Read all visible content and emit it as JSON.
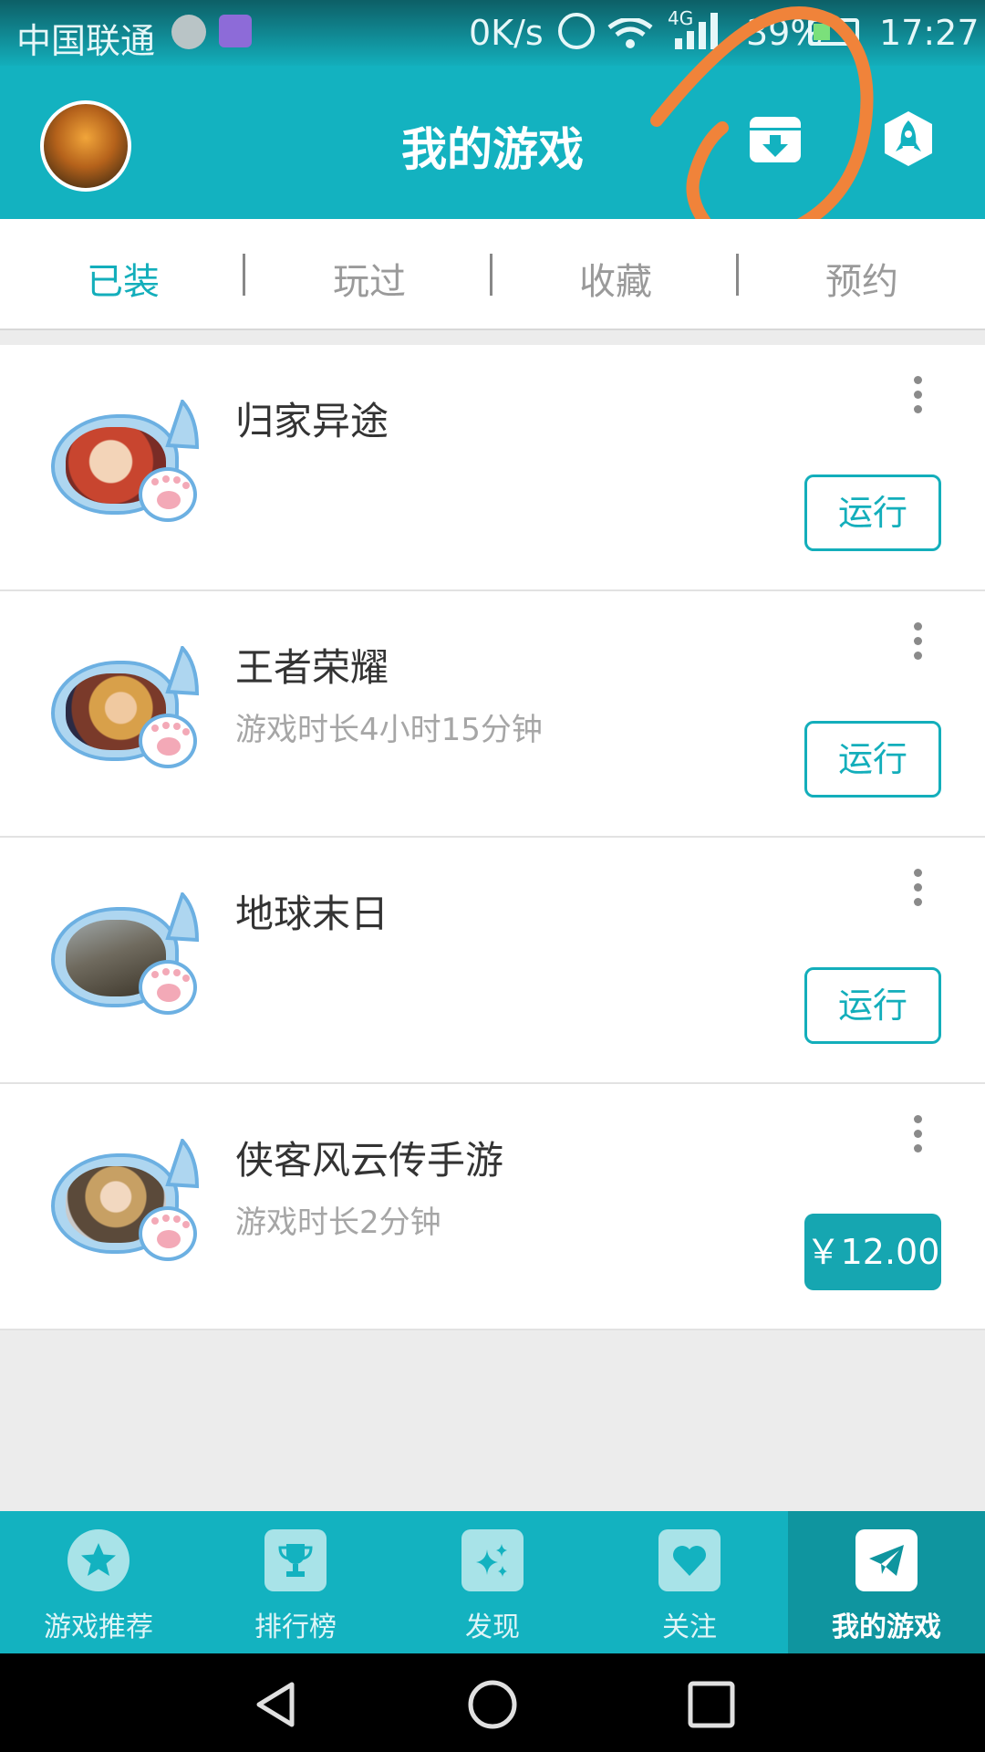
{
  "status_bar": {
    "carrier": "中国联通",
    "speed": "0K/s",
    "network": "4G",
    "battery": "39%",
    "time": "17:27"
  },
  "header": {
    "title": "我的游戏"
  },
  "tabs": [
    {
      "label": "已装",
      "active": true
    },
    {
      "label": "玩过",
      "active": false
    },
    {
      "label": "收藏",
      "active": false
    },
    {
      "label": "预约",
      "active": false
    }
  ],
  "games": [
    {
      "name": "归家异途",
      "subtitle": "",
      "action": "运行"
    },
    {
      "name": "王者荣耀",
      "subtitle": "游戏时长4小时15分钟",
      "action": "运行"
    },
    {
      "name": "地球末日",
      "subtitle": "",
      "action": "运行"
    },
    {
      "name": "侠客风云传手游",
      "subtitle": "游戏时长2分钟",
      "action": "￥12.00"
    }
  ],
  "bottom_nav": [
    {
      "label": "游戏推荐",
      "icon": "star-icon"
    },
    {
      "label": "排行榜",
      "icon": "trophy-icon"
    },
    {
      "label": "发现",
      "icon": "sparkle-icon"
    },
    {
      "label": "关注",
      "icon": "heart-icon"
    },
    {
      "label": "我的游戏",
      "icon": "paper-plane-icon",
      "active": true
    }
  ],
  "colors": {
    "accent": "#13b2c0",
    "accent_dark": "#0f959f",
    "annotation": "#f0833a"
  }
}
